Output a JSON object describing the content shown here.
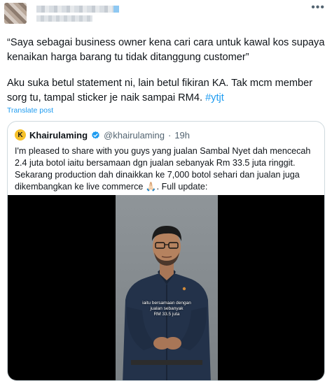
{
  "post": {
    "paragraph1": "“Saya sebagai business owner kena cari cara untuk kawal kos supaya kenaikan harga barang tu tidak ditanggung customer”",
    "paragraph2": "Aku suka betul statement ni, lain betul fikiran KA. Tak mcm member sorg tu, tampal sticker je naik sampai RM4. ",
    "hashtag": "#ytjt",
    "translate": "Translate post",
    "more_icon": "more-horizontal-icon"
  },
  "quoted": {
    "avatar_letter": "K",
    "name": "Khairulaming",
    "handle": "@khairulaming",
    "separator": "·",
    "time": "19h",
    "text": "I'm pleased to share with you guys yang jualan Sambal Nyet dah mencecah 2.4 juta botol iaitu bersamaan dgn jualan sebanyak Rm 33.5 juta ringgit. Sekarang production dah dinaikkan ke 7,000 botol sehari dan jualan juga dikembangkan ke live commerce 🙏🏻. Full update:",
    "video_caption": [
      "iaitu bersamaan dengan",
      "jualan sebanyak",
      "RM 33.5 juta"
    ]
  },
  "colors": {
    "link": "#1d9bf0",
    "verified": "#1d9bf0",
    "text": "#0f1419",
    "muted": "#536471",
    "border": "#cfd9de"
  }
}
